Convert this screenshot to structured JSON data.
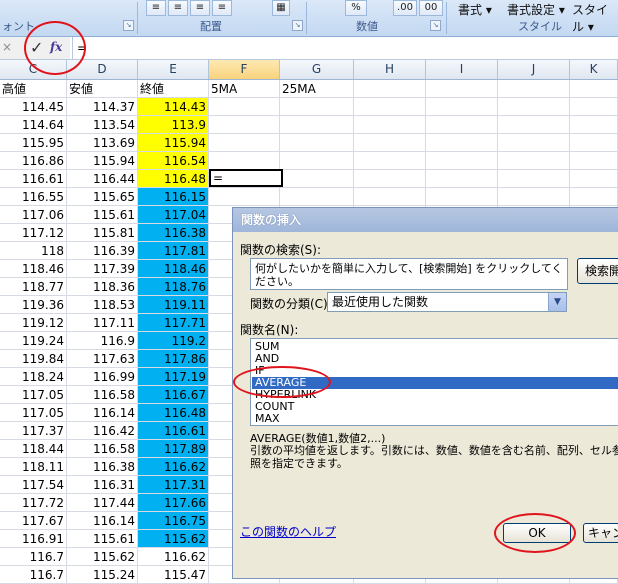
{
  "ribbon": {
    "group_font": "ォント",
    "group_align": "配置",
    "group_number": "数値",
    "group_style": "スタイル",
    "menu_format": "書式",
    "menu_cond_format": "書式設定",
    "menu_style": "スタイル",
    "num_pct": "%",
    "num_inc": ".00",
    "num_dec": "00"
  },
  "formula_bar": {
    "cancel_glyph": "×",
    "enter_glyph": "✓",
    "fx_label": "fx",
    "content": "="
  },
  "columns": [
    "C",
    "D",
    "E",
    "F",
    "G",
    "H",
    "I",
    "J",
    "K"
  ],
  "header_row": [
    "高値",
    "安値",
    "終値",
    "5MA",
    "25MA"
  ],
  "rows": [
    [
      "114.45",
      "114.37",
      "114.43"
    ],
    [
      "114.64",
      "113.54",
      "113.9"
    ],
    [
      "115.95",
      "113.69",
      "115.94"
    ],
    [
      "116.86",
      "115.94",
      "116.54"
    ],
    [
      "116.61",
      "116.44",
      "116.48"
    ],
    [
      "116.55",
      "115.65",
      "116.15"
    ],
    [
      "117.06",
      "115.61",
      "117.04"
    ],
    [
      "117.12",
      "115.81",
      "116.38"
    ],
    [
      "118",
      "116.39",
      "117.81"
    ],
    [
      "118.46",
      "117.39",
      "118.46"
    ],
    [
      "118.77",
      "118.36",
      "118.76"
    ],
    [
      "119.36",
      "118.53",
      "119.11"
    ],
    [
      "119.12",
      "117.11",
      "117.71"
    ],
    [
      "119.24",
      "116.9",
      "119.2"
    ],
    [
      "119.84",
      "117.63",
      "117.86"
    ],
    [
      "118.24",
      "116.99",
      "117.19"
    ],
    [
      "117.05",
      "116.58",
      "116.67"
    ],
    [
      "117.05",
      "116.14",
      "116.48"
    ],
    [
      "117.37",
      "116.42",
      "116.61"
    ],
    [
      "118.44",
      "116.58",
      "117.89"
    ],
    [
      "118.11",
      "116.38",
      "116.62"
    ],
    [
      "117.54",
      "116.31",
      "117.31"
    ],
    [
      "117.72",
      "117.44",
      "117.66"
    ],
    [
      "117.67",
      "116.14",
      "116.75"
    ],
    [
      "116.91",
      "115.61",
      "115.62"
    ],
    [
      "116.7",
      "115.62",
      "116.62"
    ],
    [
      "116.7",
      "115.24",
      "115.47"
    ]
  ],
  "active_cell_text": "=",
  "colors": {
    "yellow": "#ffff00",
    "blue": "#00b0f0",
    "annotation_red": "#e0141c",
    "selection_blue": "#316ac5"
  },
  "dialog": {
    "title": "関数の挿入",
    "search_label": "関数の検索(S):",
    "search_placeholder": "何がしたいかを簡単に入力して、[検索開始] をクリックしてください。",
    "search_button": "検索開",
    "category_label": "関数の分類(C):",
    "category_value": "最近使用した関数",
    "fn_list_label": "関数名(N):",
    "functions": [
      "SUM",
      "AND",
      "IF",
      "AVERAGE",
      "HYPERLINK",
      "COUNT",
      "MAX"
    ],
    "selected_function": "AVERAGE",
    "syntax": "AVERAGE(数値1,数値2,...)",
    "description": "引数の平均値を返します。引数には、数値、数値を含む名前、配列、セル参照を指定できます。",
    "help_link": "この関数のヘルプ",
    "ok_button": "OK",
    "cancel_button": "キャンセル"
  }
}
